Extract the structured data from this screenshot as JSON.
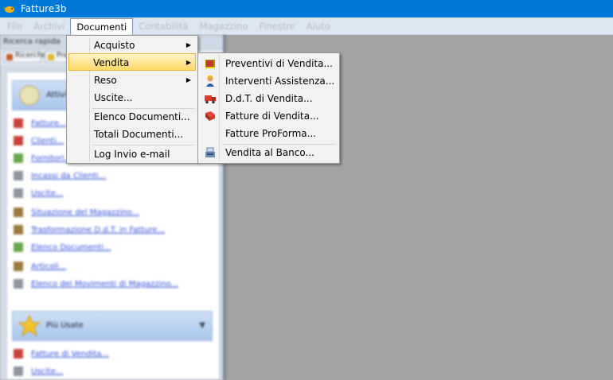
{
  "window": {
    "title": "Fatture3b"
  },
  "menubar": {
    "items": [
      "File",
      "Archivi",
      "Documenti",
      "Contabilità",
      "Magazzino",
      "Finestre",
      "Aiuto"
    ],
    "active_index": 2
  },
  "left_panel": {
    "header": "Ricerca rapida",
    "tabs": [
      "Ricerche",
      "Preferiti"
    ],
    "groups": [
      {
        "label": "Attività"
      },
      {
        "label": "Più Usate"
      }
    ],
    "links_group1": [
      "Fatture...",
      "Clienti...",
      "Fornitori...",
      "Incassi da Clienti...",
      "Uscite...",
      "Situazione del Magazzino...",
      "Trasformazione D.d.T. in Fatture...",
      "Elenco Documenti...",
      "Articoli...",
      "Elenco dei Movimenti di Magazzino..."
    ],
    "links_group2": [
      "Fatture di Vendita...",
      "Uscite..."
    ]
  },
  "documenti_menu": {
    "items": [
      {
        "label": "Acquisto",
        "has_submenu": true
      },
      {
        "label": "Vendita",
        "has_submenu": true
      },
      {
        "label": "Reso",
        "has_submenu": true
      },
      {
        "label": "Uscite..."
      },
      {
        "label": "Elenco Documenti..."
      },
      {
        "label": "Totali Documenti..."
      },
      {
        "label": "Log Invio e-mail"
      }
    ],
    "highlighted_index": 1
  },
  "vendita_submenu": {
    "items": [
      {
        "label": "Preventivi di Vendita...",
        "icon": "folder-icon"
      },
      {
        "label": "Interventi Assistenza...",
        "icon": "technician-icon"
      },
      {
        "label": "D.d.T. di Vendita...",
        "icon": "truck-icon"
      },
      {
        "label": "Fatture di Vendita...",
        "icon": "invoice-book-icon"
      },
      {
        "label": "Fatture ProForma...",
        "icon": ""
      },
      {
        "label": "Vendita al Banco...",
        "icon": "cash-register-icon"
      }
    ]
  },
  "colors": {
    "titlebar": "#0078d7",
    "menu_highlight": "#ffd866",
    "workspace": "#a3a3a3"
  }
}
